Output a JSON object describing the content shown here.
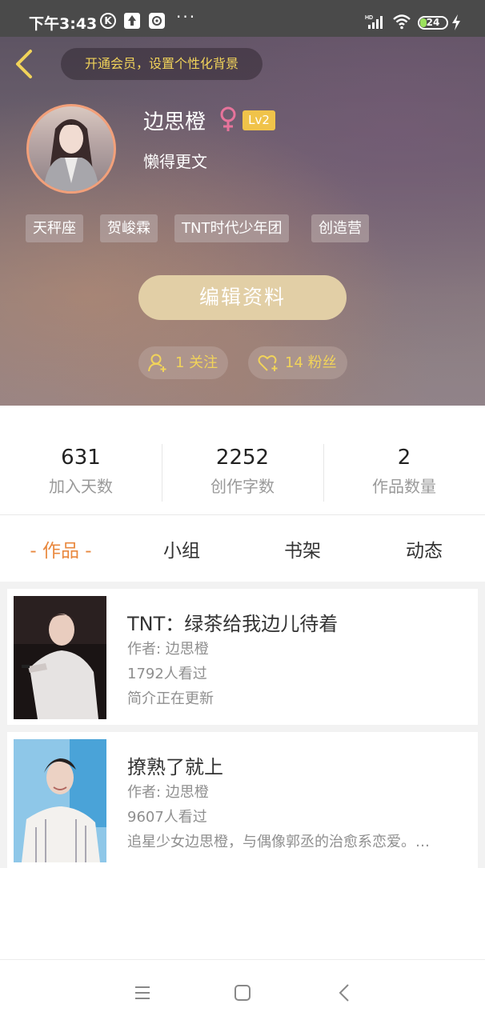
{
  "status_bar": {
    "time": "下午3:43",
    "k_icon": "K",
    "more": "···",
    "battery": "24",
    "battery_level": 0.24
  },
  "header": {
    "vip_prompt": "开通会员，设置个性化背景",
    "username": "边思橙",
    "gender": "female-icon",
    "level": "Lv2",
    "signature": "懒得更文",
    "tags": [
      "天秤座",
      "贺峻霖",
      "TNT时代少年团",
      "创造营"
    ],
    "edit_label": "编辑资料",
    "following_label": "1 关注",
    "fans_label": "14 粉丝",
    "accent_color": "#f1d35a"
  },
  "stats": [
    {
      "value": "631",
      "label": "加入天数"
    },
    {
      "value": "2252",
      "label": "创作字数"
    },
    {
      "value": "2",
      "label": "作品数量"
    }
  ],
  "tabs": [
    {
      "label": "- 作品 -",
      "active": true
    },
    {
      "label": "小组",
      "active": false
    },
    {
      "label": "书架",
      "active": false
    },
    {
      "label": "动态",
      "active": false
    }
  ],
  "works": [
    {
      "title": "TNT：绿茶给我边儿待着",
      "author": "作者: 边思橙",
      "views": "1792人看过",
      "intro": "简介正在更新"
    },
    {
      "title": "撩熟了就上",
      "author": "作者: 边思橙",
      "views": "9607人看过",
      "intro": "追星少女边思橙，与偶像郭丞的治愈系恋爱。…"
    }
  ],
  "nav": {
    "menu": "menu-icon",
    "home": "home-icon",
    "back": "back-icon"
  }
}
